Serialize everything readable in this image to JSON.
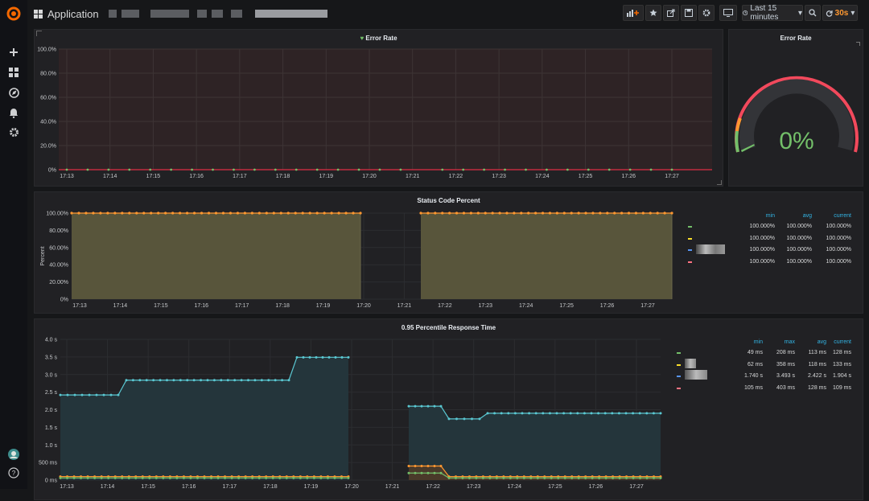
{
  "topbar": {
    "app_title": "Application",
    "time_range": "Last 15 minutes",
    "refresh_interval": "30s"
  },
  "sidebar": {
    "items": [
      "grafana-logo-icon",
      "plus-icon",
      "dashboards-icon",
      "explore-icon",
      "alert-bell-icon",
      "gear-icon"
    ],
    "bottom": [
      "avatar",
      "help-icon"
    ]
  },
  "time_ticks": [
    "17:13",
    "17:14",
    "17:15",
    "17:16",
    "17:17",
    "17:18",
    "17:19",
    "17:20",
    "17:21",
    "17:22",
    "17:23",
    "17:24",
    "17:25",
    "17:26",
    "17:27"
  ],
  "error_panel": {
    "title": "Error Rate",
    "y_ticks": [
      "100.0%",
      "80.0%",
      "60.0%",
      "40.0%",
      "20.0%",
      "0%"
    ],
    "chart_data": {
      "type": "line",
      "ylim": [
        0,
        100
      ],
      "series": [
        {
          "values": [
            0,
            0,
            0,
            0,
            0,
            0,
            0,
            0,
            0,
            0,
            0,
            0,
            0,
            0,
            0
          ]
        }
      ],
      "gap": [
        "17:20",
        "17:21"
      ],
      "color": "#73bf69"
    }
  },
  "gauge_panel": {
    "title": "Error Rate",
    "value": "0%",
    "value_num": 0,
    "colors": {
      "ok": "#73bf69",
      "warn": "#ff9830",
      "crit": "#f2495c"
    }
  },
  "status_panel": {
    "title": "Status Code Percent",
    "ylabel": "Percent",
    "y_ticks": [
      "100.00%",
      "80.00%",
      "60.00%",
      "40.00%",
      "20.00%",
      "0%"
    ],
    "legend_headers": [
      "min",
      "avg",
      "current"
    ],
    "legend_rows": [
      {
        "color": "#73bf69",
        "values": [
          "100.000%",
          "100.000%",
          "100.000%"
        ]
      },
      {
        "color": "#fade2a",
        "values": [
          "100.000%",
          "100.000%",
          "100.000%"
        ]
      },
      {
        "color": "#5794f2",
        "values": [
          "100.000%",
          "100.000%",
          "100.000%"
        ]
      },
      {
        "color": "#ff7383",
        "values": [
          "100.000%",
          "100.000%",
          "100.000%"
        ]
      }
    ],
    "chart_data": {
      "type": "area",
      "ylim": [
        0,
        100
      ],
      "series": [
        {
          "values": [
            100,
            100,
            100,
            100,
            100,
            100,
            100,
            100,
            null,
            null,
            100,
            100,
            100,
            100,
            100,
            100
          ]
        }
      ],
      "color": "#ff9830"
    }
  },
  "response_panel": {
    "title": "0.95 Percentile Response Time",
    "y_ticks": [
      "4.0 s",
      "3.5 s",
      "3.0 s",
      "2.5 s",
      "2.0 s",
      "1.5 s",
      "1.0 s",
      "500 ms",
      "0 ms"
    ],
    "legend_headers": [
      "min",
      "max",
      "avg",
      "current"
    ],
    "legend_rows": [
      {
        "color": "#73bf69",
        "values": [
          "49 ms",
          "208 ms",
          "113 ms",
          "128 ms"
        ]
      },
      {
        "color": "#fade2a",
        "values": [
          "62 ms",
          "358 ms",
          "118 ms",
          "133 ms"
        ]
      },
      {
        "color": "#5794f2",
        "values": [
          "1.740 s",
          "3.493 s",
          "2.422 s",
          "1.904 s"
        ]
      },
      {
        "color": "#ff7383",
        "values": [
          "105 ms",
          "403 ms",
          "128 ms",
          "109 ms"
        ]
      }
    ],
    "chart_data": {
      "type": "line",
      "ylim": [
        0,
        4.0
      ],
      "series": [
        {
          "color": "#5ac8d2",
          "values": [
            2.42,
            2.42,
            2.84,
            2.84,
            2.84,
            2.84,
            3.49,
            3.49,
            null,
            2.1,
            1.74,
            1.9,
            1.9,
            1.9,
            1.9,
            1.9
          ]
        },
        {
          "color": "#ff9830",
          "values": [
            0.1,
            0.1,
            0.1,
            0.1,
            0.1,
            0.1,
            0.1,
            0.1,
            null,
            0.4,
            0.1,
            0.1,
            0.1,
            0.1,
            0.1,
            0.1
          ]
        },
        {
          "color": "#73bf69",
          "values": [
            0.06,
            0.06,
            0.06,
            0.06,
            0.06,
            0.06,
            0.06,
            0.06,
            null,
            0.2,
            0.06,
            0.06,
            0.06,
            0.06,
            0.06,
            0.06
          ]
        }
      ]
    }
  }
}
